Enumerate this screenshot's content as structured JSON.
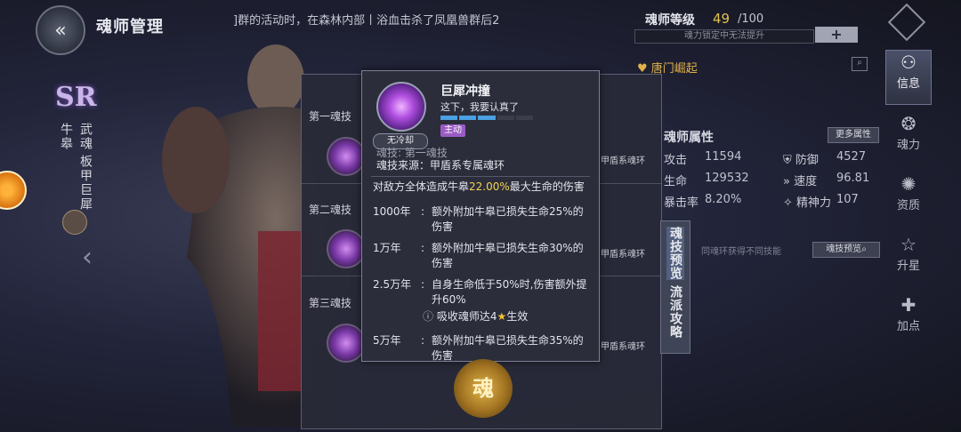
{
  "header": {
    "title": "魂师管理",
    "ticker": "]群的活动时，在森林内部丨浴血击杀了凤凰兽群后2"
  },
  "character": {
    "rarity": "SR",
    "name": "牛皋",
    "title_a": "武魂",
    "title_b": "板甲巨犀"
  },
  "rings": {
    "labels": [
      "第一魂技",
      "第二魂技",
      "第三魂技"
    ],
    "source_suffix": "甲盾系魂环"
  },
  "tooltip": {
    "cooldown": "无冷却",
    "name": "巨犀冲撞",
    "quote": "这下，我要认真了",
    "tag": "主动",
    "energy_filled": 3,
    "energy_total": 5,
    "partial_line": "魂技: 第一魂技",
    "source_label": "魂技来源：甲盾系专属魂环",
    "desc_prefix": "对敌方全体造成牛皋",
    "desc_value": "22.00%",
    "desc_suffix": "最大生命的伤害",
    "tiers": [
      {
        "year": "1000年",
        "text": "额外附加牛皋已损失生命25%的伤害"
      },
      {
        "year": "1万年",
        "text": "额外附加牛皋已损失生命30%的伤害"
      },
      {
        "year": "2.5万年",
        "text": "自身生命低于50%时,伤害额外提升60%"
      },
      {
        "year": "5万年",
        "text": "额外附加牛皋已损失生命35%的伤害"
      }
    ],
    "condition": "吸收魂师达4",
    "condition_suffix": "生效"
  },
  "right": {
    "level_label": "魂师等级",
    "level": "49",
    "level_max": "/100",
    "level_hint": "魂力锁定中无法提升",
    "plus": "+",
    "faction": "唐门崛起",
    "attr_title": "魂师属性",
    "more_attr": "更多属性",
    "attrs": [
      {
        "k": "攻击",
        "v": "11594",
        "k2": "防御",
        "v2": "4527"
      },
      {
        "k": "生命",
        "v": "129532",
        "k2": "速度",
        "v2": "96.81"
      },
      {
        "k": "暴击率",
        "v": "8.20%",
        "k2": "精神力",
        "v2": "107"
      }
    ],
    "tab_preview": "魂技预览",
    "tab_style": "流派攻略",
    "skill_preview": "魂技预览",
    "notice": "同魂环获得不同技能"
  },
  "nav": [
    {
      "label": "信息",
      "icon": "info-icon"
    },
    {
      "label": "魂力",
      "icon": "soul-icon"
    },
    {
      "label": "资质",
      "icon": "talent-icon"
    },
    {
      "label": "升星",
      "icon": "star-icon"
    },
    {
      "label": "加点",
      "icon": "plus-icon"
    }
  ],
  "emblem": "魂",
  "colors": {
    "accent_gold": "#e2c14c",
    "highlight": "#f4d34e",
    "active_tag": "#9b5bc4"
  }
}
